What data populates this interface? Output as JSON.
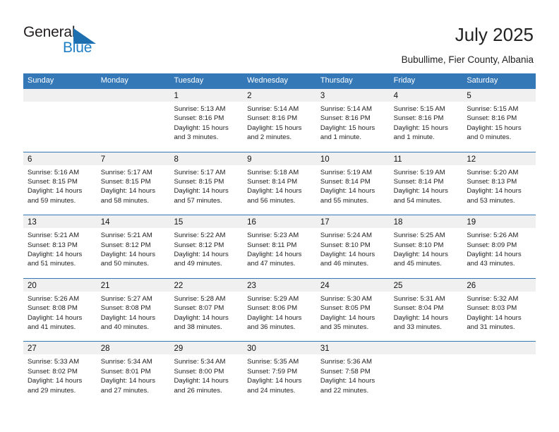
{
  "brand": {
    "name_part1": "General",
    "name_part2": "Blue",
    "triangle_icon": "triangle-icon",
    "accent_color": "#1e6fb0"
  },
  "header": {
    "title": "July 2025",
    "subtitle": "Bubullime, Fier County, Albania"
  },
  "theme": {
    "header_blue": "#3478b8",
    "band_gray": "#f0f0f0",
    "text": "#222222"
  },
  "weekdays": [
    "Sunday",
    "Monday",
    "Tuesday",
    "Wednesday",
    "Thursday",
    "Friday",
    "Saturday"
  ],
  "weeks": [
    [
      {
        "day": "",
        "l1": "",
        "l2": "",
        "l3": "",
        "l4": ""
      },
      {
        "day": "",
        "l1": "",
        "l2": "",
        "l3": "",
        "l4": ""
      },
      {
        "day": "1",
        "l1": "Sunrise: 5:13 AM",
        "l2": "Sunset: 8:16 PM",
        "l3": "Daylight: 15 hours",
        "l4": "and 3 minutes."
      },
      {
        "day": "2",
        "l1": "Sunrise: 5:14 AM",
        "l2": "Sunset: 8:16 PM",
        "l3": "Daylight: 15 hours",
        "l4": "and 2 minutes."
      },
      {
        "day": "3",
        "l1": "Sunrise: 5:14 AM",
        "l2": "Sunset: 8:16 PM",
        "l3": "Daylight: 15 hours",
        "l4": "and 1 minute."
      },
      {
        "day": "4",
        "l1": "Sunrise: 5:15 AM",
        "l2": "Sunset: 8:16 PM",
        "l3": "Daylight: 15 hours",
        "l4": "and 1 minute."
      },
      {
        "day": "5",
        "l1": "Sunrise: 5:15 AM",
        "l2": "Sunset: 8:16 PM",
        "l3": "Daylight: 15 hours",
        "l4": "and 0 minutes."
      }
    ],
    [
      {
        "day": "6",
        "l1": "Sunrise: 5:16 AM",
        "l2": "Sunset: 8:15 PM",
        "l3": "Daylight: 14 hours",
        "l4": "and 59 minutes."
      },
      {
        "day": "7",
        "l1": "Sunrise: 5:17 AM",
        "l2": "Sunset: 8:15 PM",
        "l3": "Daylight: 14 hours",
        "l4": "and 58 minutes."
      },
      {
        "day": "8",
        "l1": "Sunrise: 5:17 AM",
        "l2": "Sunset: 8:15 PM",
        "l3": "Daylight: 14 hours",
        "l4": "and 57 minutes."
      },
      {
        "day": "9",
        "l1": "Sunrise: 5:18 AM",
        "l2": "Sunset: 8:14 PM",
        "l3": "Daylight: 14 hours",
        "l4": "and 56 minutes."
      },
      {
        "day": "10",
        "l1": "Sunrise: 5:19 AM",
        "l2": "Sunset: 8:14 PM",
        "l3": "Daylight: 14 hours",
        "l4": "and 55 minutes."
      },
      {
        "day": "11",
        "l1": "Sunrise: 5:19 AM",
        "l2": "Sunset: 8:14 PM",
        "l3": "Daylight: 14 hours",
        "l4": "and 54 minutes."
      },
      {
        "day": "12",
        "l1": "Sunrise: 5:20 AM",
        "l2": "Sunset: 8:13 PM",
        "l3": "Daylight: 14 hours",
        "l4": "and 53 minutes."
      }
    ],
    [
      {
        "day": "13",
        "l1": "Sunrise: 5:21 AM",
        "l2": "Sunset: 8:13 PM",
        "l3": "Daylight: 14 hours",
        "l4": "and 51 minutes."
      },
      {
        "day": "14",
        "l1": "Sunrise: 5:21 AM",
        "l2": "Sunset: 8:12 PM",
        "l3": "Daylight: 14 hours",
        "l4": "and 50 minutes."
      },
      {
        "day": "15",
        "l1": "Sunrise: 5:22 AM",
        "l2": "Sunset: 8:12 PM",
        "l3": "Daylight: 14 hours",
        "l4": "and 49 minutes."
      },
      {
        "day": "16",
        "l1": "Sunrise: 5:23 AM",
        "l2": "Sunset: 8:11 PM",
        "l3": "Daylight: 14 hours",
        "l4": "and 47 minutes."
      },
      {
        "day": "17",
        "l1": "Sunrise: 5:24 AM",
        "l2": "Sunset: 8:10 PM",
        "l3": "Daylight: 14 hours",
        "l4": "and 46 minutes."
      },
      {
        "day": "18",
        "l1": "Sunrise: 5:25 AM",
        "l2": "Sunset: 8:10 PM",
        "l3": "Daylight: 14 hours",
        "l4": "and 45 minutes."
      },
      {
        "day": "19",
        "l1": "Sunrise: 5:26 AM",
        "l2": "Sunset: 8:09 PM",
        "l3": "Daylight: 14 hours",
        "l4": "and 43 minutes."
      }
    ],
    [
      {
        "day": "20",
        "l1": "Sunrise: 5:26 AM",
        "l2": "Sunset: 8:08 PM",
        "l3": "Daylight: 14 hours",
        "l4": "and 41 minutes."
      },
      {
        "day": "21",
        "l1": "Sunrise: 5:27 AM",
        "l2": "Sunset: 8:08 PM",
        "l3": "Daylight: 14 hours",
        "l4": "and 40 minutes."
      },
      {
        "day": "22",
        "l1": "Sunrise: 5:28 AM",
        "l2": "Sunset: 8:07 PM",
        "l3": "Daylight: 14 hours",
        "l4": "and 38 minutes."
      },
      {
        "day": "23",
        "l1": "Sunrise: 5:29 AM",
        "l2": "Sunset: 8:06 PM",
        "l3": "Daylight: 14 hours",
        "l4": "and 36 minutes."
      },
      {
        "day": "24",
        "l1": "Sunrise: 5:30 AM",
        "l2": "Sunset: 8:05 PM",
        "l3": "Daylight: 14 hours",
        "l4": "and 35 minutes."
      },
      {
        "day": "25",
        "l1": "Sunrise: 5:31 AM",
        "l2": "Sunset: 8:04 PM",
        "l3": "Daylight: 14 hours",
        "l4": "and 33 minutes."
      },
      {
        "day": "26",
        "l1": "Sunrise: 5:32 AM",
        "l2": "Sunset: 8:03 PM",
        "l3": "Daylight: 14 hours",
        "l4": "and 31 minutes."
      }
    ],
    [
      {
        "day": "27",
        "l1": "Sunrise: 5:33 AM",
        "l2": "Sunset: 8:02 PM",
        "l3": "Daylight: 14 hours",
        "l4": "and 29 minutes."
      },
      {
        "day": "28",
        "l1": "Sunrise: 5:34 AM",
        "l2": "Sunset: 8:01 PM",
        "l3": "Daylight: 14 hours",
        "l4": "and 27 minutes."
      },
      {
        "day": "29",
        "l1": "Sunrise: 5:34 AM",
        "l2": "Sunset: 8:00 PM",
        "l3": "Daylight: 14 hours",
        "l4": "and 26 minutes."
      },
      {
        "day": "30",
        "l1": "Sunrise: 5:35 AM",
        "l2": "Sunset: 7:59 PM",
        "l3": "Daylight: 14 hours",
        "l4": "and 24 minutes."
      },
      {
        "day": "31",
        "l1": "Sunrise: 5:36 AM",
        "l2": "Sunset: 7:58 PM",
        "l3": "Daylight: 14 hours",
        "l4": "and 22 minutes."
      },
      {
        "day": "",
        "l1": "",
        "l2": "",
        "l3": "",
        "l4": ""
      },
      {
        "day": "",
        "l1": "",
        "l2": "",
        "l3": "",
        "l4": ""
      }
    ]
  ]
}
